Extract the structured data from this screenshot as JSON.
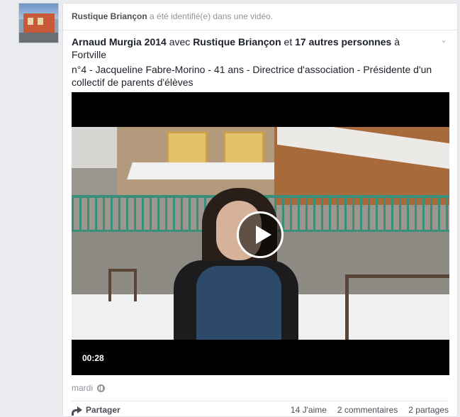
{
  "avatar_icon": "page-avatar",
  "story": {
    "page_name": "Rustique Briançon",
    "action_text": "a été identifié(e) dans une vidéo."
  },
  "post": {
    "author": "Arnaud Murgia 2014",
    "with_word": "avec",
    "tagged": "Rustique Briançon",
    "and_word": "et",
    "others": "17 autres personnes",
    "at_word": "à",
    "place": "Fortville",
    "description": "n°4 - Jacqueline Fabre-Morino - 41 ans - Directrice d'association - Présidente d'un collectif de parents d'élèves"
  },
  "video": {
    "duration": "00:28",
    "play_icon": "play-icon"
  },
  "meta": {
    "date": "mardi",
    "privacy_icon": "globe-icon"
  },
  "footer": {
    "share_label": "Partager",
    "likes": "14 J'aime",
    "comments": "2 commentaires",
    "shares": "2 partages"
  },
  "colors": {
    "background": "#e9ebee",
    "card": "#ffffff",
    "meta_text": "#90949c"
  }
}
